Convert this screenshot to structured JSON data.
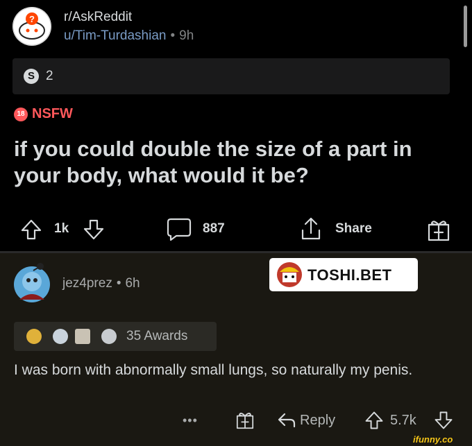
{
  "post": {
    "subreddit": "r/AskReddit",
    "author": "u/Tim-Turdashian",
    "separator": "•",
    "age": "9h",
    "award_icon_letter": "S",
    "award_count": "2",
    "nsfw_badge": "18",
    "nsfw_label": "NSFW",
    "title": "if you could double the size of a part in your body, what would it be?"
  },
  "actions": {
    "vote_count": "1k",
    "comment_count": "887",
    "share_label": "Share"
  },
  "comment": {
    "author": "jez4prez",
    "separator": "•",
    "age": "6h",
    "awards_label": "35 Awards",
    "body": "I was born with abnormally small lungs, so naturally my penis.",
    "more_label": "•••",
    "reply_label": "Reply",
    "score": "5.7k"
  },
  "sponsor": {
    "label": "TOSHI.BET"
  },
  "watermark": "ifunny.co",
  "colors": {
    "background": "#000000",
    "text": "#d7dadc",
    "link": "#7a9cc6",
    "nsfw": "#ff585b",
    "comment_bg": "#1a1812"
  },
  "icons": [
    "upvote-icon",
    "downvote-icon",
    "comment-icon",
    "share-icon",
    "gift-icon",
    "reply-icon"
  ]
}
